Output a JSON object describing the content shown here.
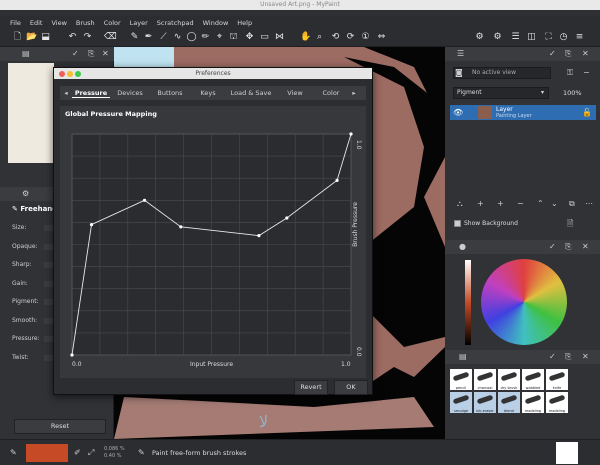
{
  "window": {
    "title": "Unsaved Art.png - MyPaint"
  },
  "menu": [
    "File",
    "Edit",
    "View",
    "Brush",
    "Color",
    "Layer",
    "Scratchpad",
    "Window",
    "Help"
  ],
  "left_panel": {
    "brush_name": "Freehand",
    "properties": [
      "Size:",
      "Opaque:",
      "Sharp:",
      "Gain:",
      "Pigment:",
      "Smooth:",
      "Pressure:",
      "Twist:"
    ],
    "reset_label": "Reset"
  },
  "layers_panel": {
    "view_select": "No active view",
    "mode_select": "Pigment",
    "opacity": "100%",
    "layer_name": "Layer",
    "layer_sub": "Painting Layer",
    "show_background": "Show Background"
  },
  "brushes": [
    "pencil",
    "charcoal",
    "dry brush",
    "wobbled",
    "knife",
    "smudge",
    "ink-eraser",
    "blend",
    "modeling",
    "modeling"
  ],
  "status": {
    "coord1": "0.086 %",
    "coord2": "0.40 %",
    "hint": "Paint free-form brush strokes"
  },
  "dialog": {
    "title": "Preferences",
    "tabs": [
      "Pressure",
      "Devices",
      "Buttons",
      "Keys",
      "Load & Save",
      "View",
      "Color"
    ],
    "section_title": "Global Pressure Mapping",
    "revert_label": "Revert",
    "ok_label": "OK"
  },
  "colors": {
    "brush_color": "#c64a26",
    "accent": "#2f6db3",
    "canvas_skin": "#9c6b62"
  },
  "chart_data": {
    "type": "line",
    "xlabel": "Input Pressure",
    "ylabel": "Brush Pressure",
    "xlim": [
      0,
      1
    ],
    "ylim": [
      0,
      1
    ],
    "x_ticks": [
      "0.0",
      "1.0"
    ],
    "y_ticks": [
      "0.0",
      "1.0"
    ],
    "grid": true,
    "x": [
      0.0,
      0.07,
      0.26,
      0.39,
      0.67,
      0.77,
      0.95,
      1.0
    ],
    "y": [
      0.0,
      0.59,
      0.7,
      0.58,
      0.54,
      0.62,
      0.79,
      1.0
    ]
  }
}
